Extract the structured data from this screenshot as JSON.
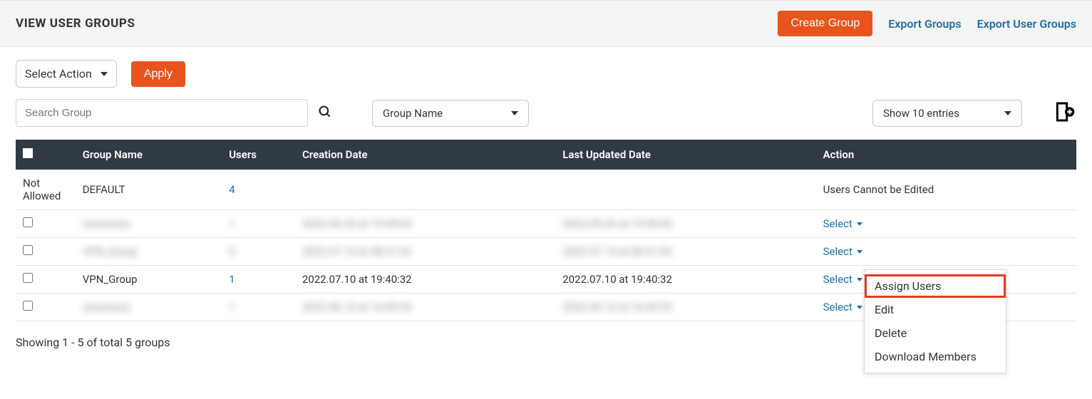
{
  "header": {
    "title": "VIEW USER GROUPS",
    "create_button": "Create Group",
    "export_groups": "Export Groups",
    "export_user_groups": "Export User Groups"
  },
  "toolbar": {
    "select_action": "Select Action",
    "apply": "Apply"
  },
  "filters": {
    "search_placeholder": "Search Group",
    "group_name_dropdown": "Group Name",
    "entries_dropdown": "Show 10 entries"
  },
  "table": {
    "columns": {
      "name": "Group Name",
      "users": "Users",
      "creation": "Creation Date",
      "updated": "Last Updated Date",
      "action": "Action"
    },
    "rows": [
      {
        "chk_text": "Not Allowed",
        "name": "DEFAULT",
        "users": "4",
        "creation": "",
        "updated": "",
        "action_text": "Users Cannot be Edited",
        "action_type": "text",
        "blurred": false
      },
      {
        "chk_text": "",
        "name": "xxxxxxxxx",
        "users": "1",
        "creation": "2022.05.26 at 19:49:03",
        "updated": "2022.05.26 at 19:49:03",
        "action_text": "Select",
        "action_type": "select",
        "blurred": true
      },
      {
        "chk_text": "",
        "name": "VPN_Group",
        "users": "0",
        "creation": "2022.07.14 at 08:31:42",
        "updated": "2022.07.14 at 08:31:42",
        "action_text": "Select",
        "action_type": "select",
        "blurred": true
      },
      {
        "chk_text": "",
        "name": "VPN_Group",
        "users": "1",
        "creation": "2022.07.10 at 19:40:32",
        "updated": "2022.07.10 at 19:40:32",
        "action_text": "Select",
        "action_type": "select",
        "blurred": false
      },
      {
        "chk_text": "",
        "name": "xxxxxxxxx",
        "users": "1",
        "creation": "2022.06.16 at 16:49:33",
        "updated": "2022.06.16 at 16:49:33",
        "action_text": "Select",
        "action_type": "select",
        "blurred": true
      }
    ]
  },
  "dropdown_menu": {
    "items": [
      {
        "label": "Assign Users",
        "highlighted": true
      },
      {
        "label": "Edit",
        "highlighted": false
      },
      {
        "label": "Delete",
        "highlighted": false
      },
      {
        "label": "Download Members",
        "highlighted": false
      }
    ]
  },
  "footer": {
    "summary": "Showing 1 - 5 of total 5 groups"
  }
}
